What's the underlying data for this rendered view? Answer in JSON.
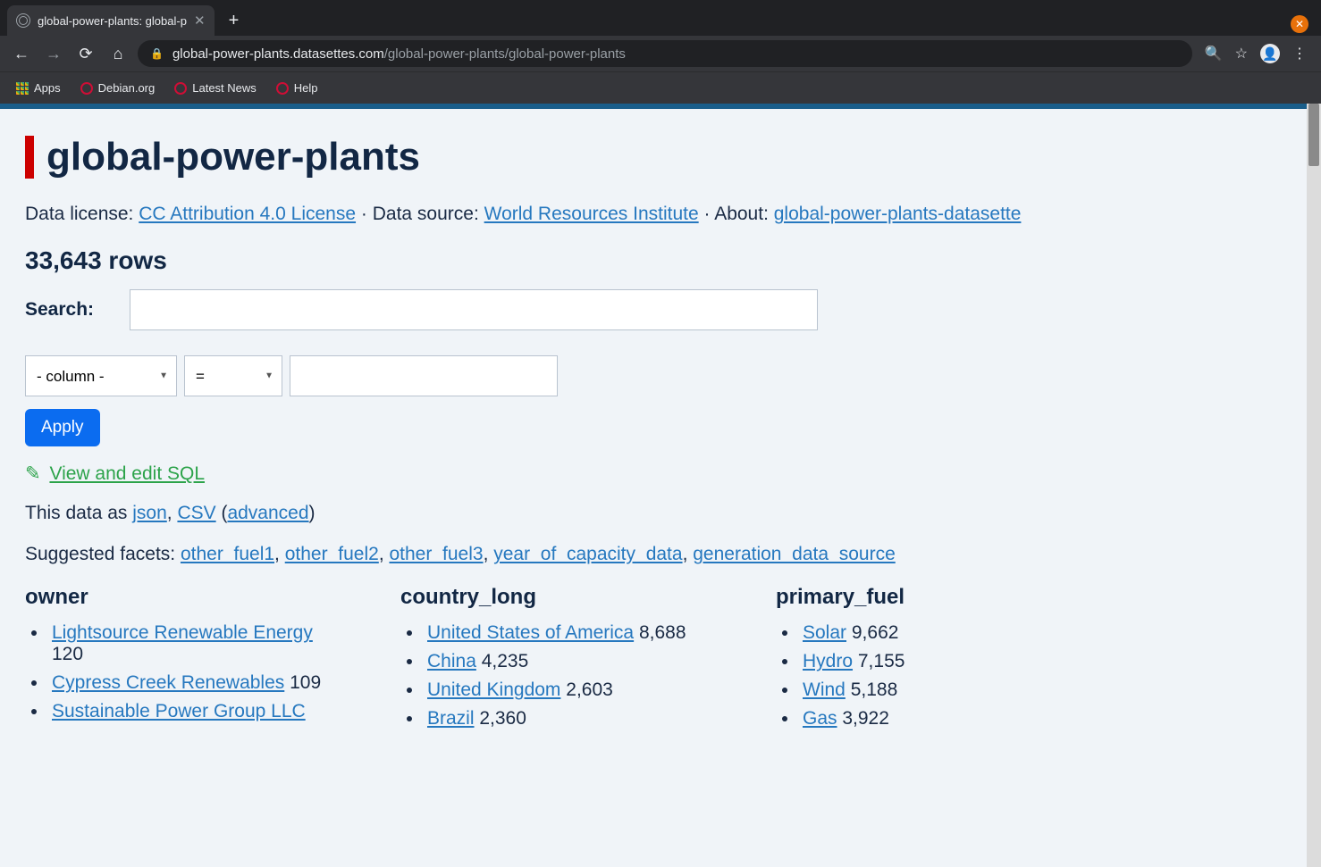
{
  "browser": {
    "tab_title": "global-power-plants: global-p",
    "url_host": "global-power-plants.datasettes.com",
    "url_path": "/global-power-plants/global-power-plants",
    "bookmarks": {
      "apps": "Apps",
      "debian": "Debian.org",
      "latest_news": "Latest News",
      "help": "Help"
    }
  },
  "page": {
    "title": "global-power-plants",
    "meta": {
      "license_label": "Data license: ",
      "license_link": "CC Attribution 4.0 License",
      "source_label": "Data source: ",
      "source_link": "World Resources Institute",
      "about_label": "About: ",
      "about_link": "global-power-plants-datasette"
    },
    "rows_heading": "33,643 rows",
    "search_label": "Search:",
    "filter": {
      "column_placeholder": "- column -",
      "op_placeholder": "="
    },
    "apply_label": "Apply",
    "sql_link": "View and edit SQL",
    "data_as": {
      "prefix": "This data as ",
      "json": "json",
      "csv": "CSV",
      "advanced": "advanced"
    },
    "suggested_label": "Suggested facets: ",
    "suggested_facets": [
      "other_fuel1",
      "other_fuel2",
      "other_fuel3",
      "year_of_capacity_data",
      "generation_data_source"
    ],
    "facets": {
      "owner": {
        "title": "owner",
        "items": [
          {
            "label": "Lightsource Renewable Energy",
            "count": "120"
          },
          {
            "label": "Cypress Creek Renewables",
            "count": "109"
          },
          {
            "label": "Sustainable Power Group LLC",
            "count": ""
          }
        ]
      },
      "country_long": {
        "title": "country_long",
        "items": [
          {
            "label": "United States of America",
            "count": "8,688"
          },
          {
            "label": "China",
            "count": "4,235"
          },
          {
            "label": "United Kingdom",
            "count": "2,603"
          },
          {
            "label": "Brazil",
            "count": "2,360"
          }
        ]
      },
      "primary_fuel": {
        "title": "primary_fuel",
        "items": [
          {
            "label": "Solar",
            "count": "9,662"
          },
          {
            "label": "Hydro",
            "count": "7,155"
          },
          {
            "label": "Wind",
            "count": "5,188"
          },
          {
            "label": "Gas",
            "count": "3,922"
          }
        ]
      }
    }
  }
}
